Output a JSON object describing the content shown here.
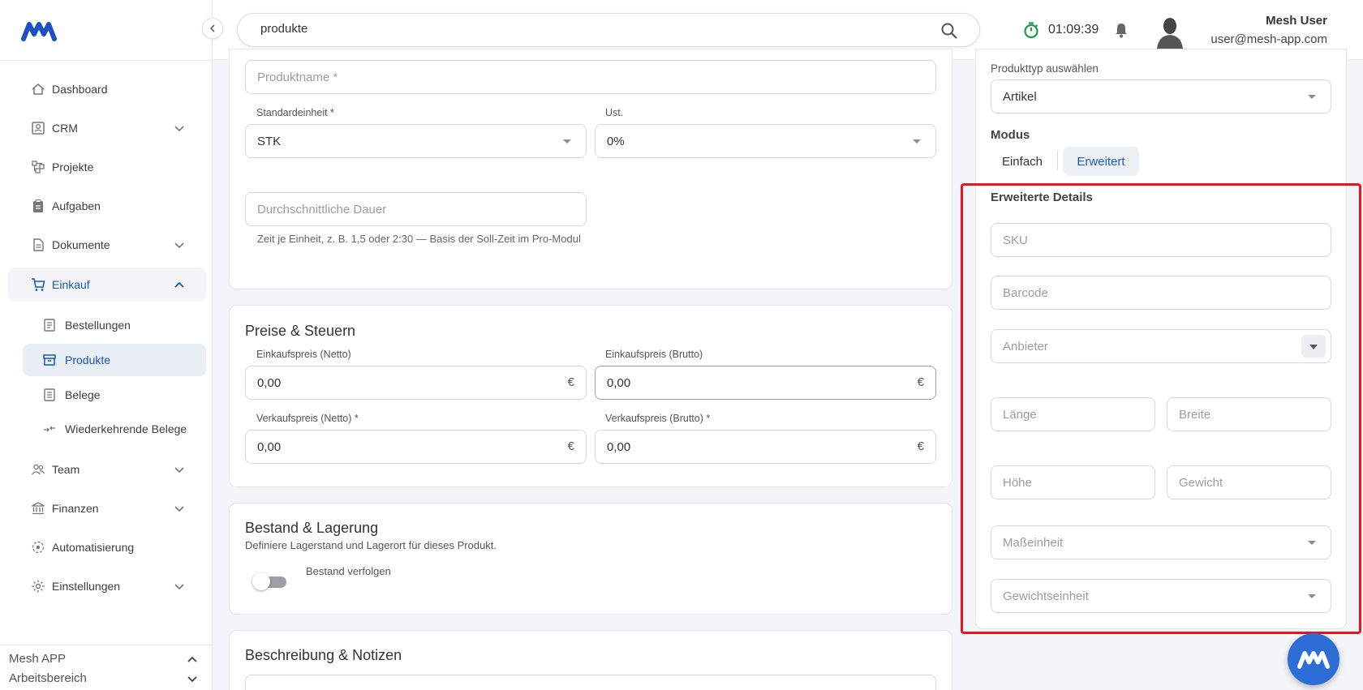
{
  "header": {
    "search_value": "produkte",
    "timer": "01:09:39",
    "user_name": "Mesh User",
    "user_email": "user@mesh-app.com"
  },
  "sidebar": {
    "items": [
      {
        "label": "Dashboard",
        "icon": "home-icon"
      },
      {
        "label": "CRM",
        "icon": "contacts-icon"
      },
      {
        "label": "Projekte",
        "icon": "project-icon"
      },
      {
        "label": "Aufgaben",
        "icon": "clipboard-icon"
      },
      {
        "label": "Dokumente",
        "icon": "document-icon"
      },
      {
        "label": "Einkauf",
        "icon": "cart-icon"
      },
      {
        "label": "Team",
        "icon": "team-icon"
      },
      {
        "label": "Finanzen",
        "icon": "bank-icon"
      },
      {
        "label": "Automatisierung",
        "icon": "automation-icon"
      },
      {
        "label": "Einstellungen",
        "icon": "gear-icon"
      }
    ],
    "sub_items": [
      {
        "label": "Bestellungen",
        "icon": "order-icon"
      },
      {
        "label": "Produkte",
        "icon": "archive-icon"
      },
      {
        "label": "Belege",
        "icon": "receipt-icon"
      },
      {
        "label": "Wiederkehrende Belege",
        "icon": "recurring-icon"
      }
    ],
    "workspace": {
      "app": "Mesh APP",
      "area": "Arbeitsbereich"
    }
  },
  "basics": {
    "name_placeholder": "Produktname *",
    "unit_label": "Standardeinheit *",
    "unit_value": "STK",
    "vat_label": "Ust.",
    "vat_value": "0%",
    "duration_placeholder": "Durchschnittliche Dauer",
    "duration_hint": "Zeit je Einheit, z. B. 1,5 oder 2:30 — Basis der Soll-Zeit im Pro-Modul"
  },
  "prices": {
    "title": "Preise & Steuern",
    "buy_net_label": "Einkaufspreis (Netto)",
    "buy_net_value": "0,00",
    "buy_gross_label": "Einkaufspreis (Brutto)",
    "buy_gross_value": "0,00",
    "sell_net_label": "Verkaufspreis (Netto) *",
    "sell_net_value": "0,00",
    "sell_gross_label": "Verkaufspreis (Brutto) *",
    "sell_gross_value": "0,00",
    "currency": "€"
  },
  "stock": {
    "title": "Bestand & Lagerung",
    "subtitle": "Definiere Lagerstand und Lagerort für dieses Produkt.",
    "toggle_label": "Bestand verfolgen",
    "toggle_on": false
  },
  "notes": {
    "title": "Beschreibung & Notizen"
  },
  "right": {
    "type_label": "Produkttyp auswählen",
    "type_value": "Artikel",
    "mode_label": "Modus",
    "mode_simple": "Einfach",
    "mode_advanced": "Erweitert",
    "details_title": "Erweiterte Details",
    "sku": "SKU",
    "barcode": "Barcode",
    "vendor": "Anbieter",
    "length": "Länge",
    "width": "Breite",
    "height": "Höhe",
    "weight": "Gewicht",
    "dimension_unit": "Maßeinheit",
    "weight_unit": "Gewichtseinheit"
  },
  "colors": {
    "accent": "#1a56b0",
    "highlight": "#e4181b",
    "fab": "#2d6ed6"
  }
}
